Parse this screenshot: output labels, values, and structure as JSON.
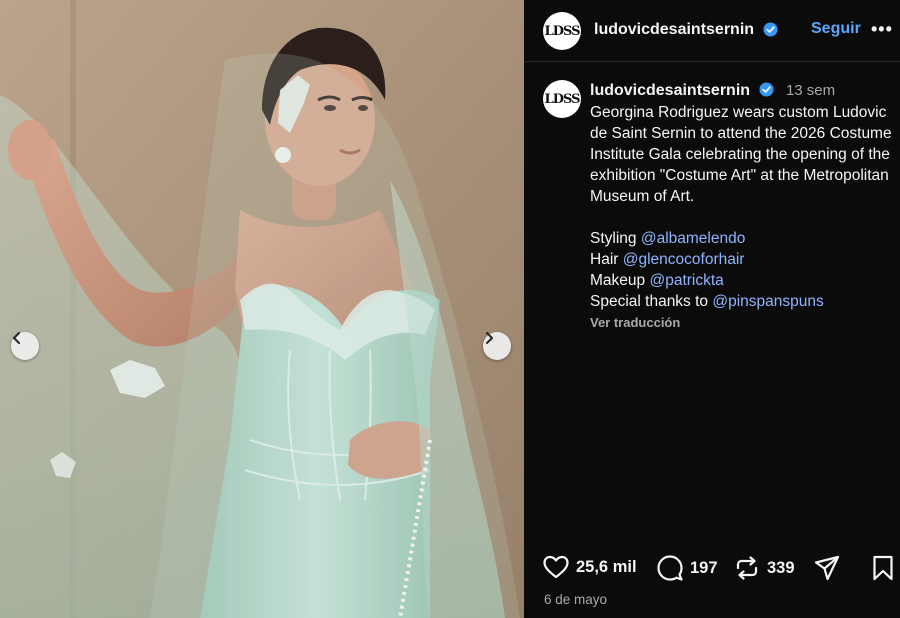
{
  "media": {
    "nav_prev_icon": "chevron-left-icon",
    "nav_next_icon": "chevron-right-icon"
  },
  "header": {
    "avatar_text": "LDSS",
    "username": "ludovicdesaintsernin",
    "verified_icon": "verified-badge-icon",
    "follow_label": "Seguir",
    "more_label": "•••"
  },
  "caption": {
    "avatar_text": "LDSS",
    "username": "ludovicdesaintsernin",
    "time_ago": "13 sem",
    "text": "Georgina Rodriguez wears custom Ludovic de Saint Sernin to attend the 2026 Costume Institute Gala celebrating the opening of the exhibition \"Costume Art\" at the Metropolitan Museum of Art.",
    "credits": [
      {
        "role": "Styling",
        "handle": "@albamelendo"
      },
      {
        "role": "Hair",
        "handle": "@glencocoforhair"
      },
      {
        "role": "Makeup",
        "handle": "@patrickta"
      },
      {
        "role": "Special thanks to",
        "handle": "@pinspanspuns"
      }
    ],
    "translate_label": "Ver traducción"
  },
  "actions": {
    "likes": "25,6 mil",
    "comments": "197",
    "reposts": "339",
    "icons": [
      "heart-icon",
      "comment-icon",
      "repost-icon",
      "share-icon",
      "bookmark-icon"
    ]
  },
  "date": "6 de mayo",
  "colors": {
    "background": "#0b0b0b",
    "accent_blue": "#5aa6ff",
    "mention_blue": "#8fb4ff",
    "muted_text": "#a8a8a8",
    "dress_mint": "#a8cfc1"
  }
}
